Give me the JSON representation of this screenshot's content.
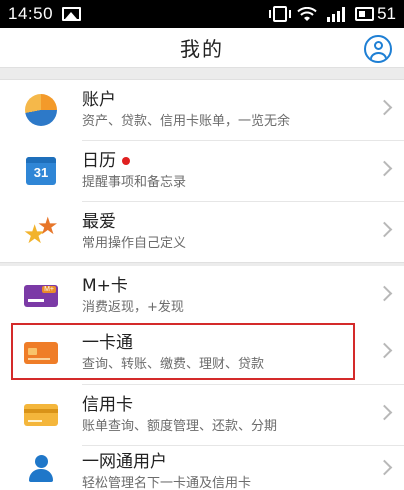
{
  "statusbar": {
    "time": "14:50",
    "battery": "51",
    "signal_bars": 4
  },
  "header": {
    "title": "我的",
    "profile_icon": "user-circle-icon"
  },
  "colors": {
    "accent": "#1e7fd4",
    "highlight": "#d42a2a",
    "badge": "#e02020"
  },
  "groups": [
    [
      {
        "key": "account",
        "title": "账户",
        "subtitle": "资产、贷款、信用卡账单，一览无余",
        "icon": "pie-chart-icon",
        "badge": false
      },
      {
        "key": "calendar",
        "title": "日历",
        "icon_text": "31",
        "subtitle": "提醒事项和备忘录",
        "icon": "calendar-icon",
        "badge": true
      },
      {
        "key": "favorite",
        "title": "最爱",
        "subtitle": "常用操作自己定义",
        "icon": "stars-icon",
        "badge": false
      }
    ],
    [
      {
        "key": "mplus",
        "title": "M+卡",
        "icon_text": "M+",
        "subtitle": "消费返现，+发现",
        "icon": "m-plus-card-icon",
        "badge": false
      },
      {
        "key": "yikatong",
        "title": "一卡通",
        "subtitle": "查询、转账、缴费、理财、贷款",
        "icon": "debit-card-icon",
        "badge": false
      },
      {
        "key": "credit",
        "title": "信用卡",
        "subtitle": "账单查询、额度管理、还款、分期",
        "icon": "credit-card-icon",
        "badge": false
      },
      {
        "key": "netuser",
        "title": "一网通用户",
        "subtitle": "轻松管理名下一卡通及信用卡",
        "icon": "user-icon",
        "badge": false
      }
    ]
  ]
}
